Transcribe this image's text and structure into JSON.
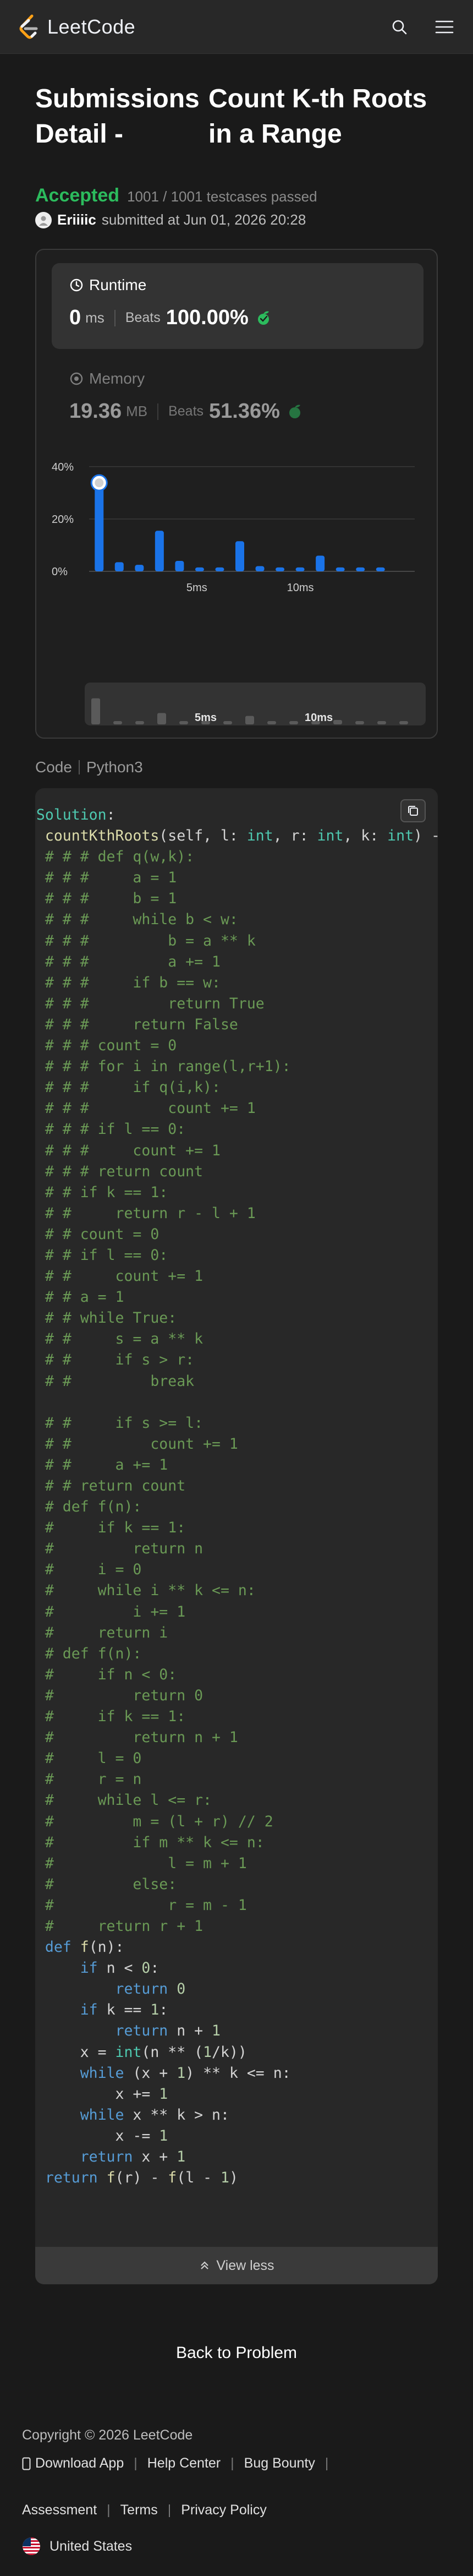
{
  "header": {
    "brand": "LeetCode"
  },
  "title": {
    "left": "Submissions Detail -",
    "right": "Count K-th Roots in a Range"
  },
  "status": {
    "accepted": "Accepted",
    "testcases": "1001 / 1001 testcases passed"
  },
  "author": {
    "name": "Eriiiic",
    "submitted": "submitted at Jun 01, 2026 20:28"
  },
  "runtime": {
    "label": "Runtime",
    "value": "0",
    "unit": "ms",
    "beats_label": "Beats",
    "beats": "100.00%"
  },
  "memory": {
    "label": "Memory",
    "value": "19.36",
    "unit": "MB",
    "beats_label": "Beats",
    "beats": "51.36%"
  },
  "chart_data": {
    "type": "bar",
    "title": "",
    "y_ticks": [
      "40%",
      "20%",
      "0%"
    ],
    "ylim": [
      0,
      45
    ],
    "x_tick_labels": [
      "5ms",
      "10ms"
    ],
    "series": [
      {
        "values": [
          35.5,
          3.5,
          2.5,
          15.5,
          4.0,
          1.5,
          1.5,
          11.5,
          2.0,
          1.5,
          1.5,
          6.0,
          1.5,
          1.5,
          1.5
        ]
      }
    ],
    "highlighted_index": 0,
    "colors": {
      "bar": "#1a73e8",
      "grid": "#3a3a3a"
    },
    "mini_x_tick_labels": [
      "5ms",
      "10ms"
    ]
  },
  "code": {
    "label": "Code",
    "language": "Python3",
    "lines": [
      "  Solution:",
      "ef countKthRoots(self, l: int, r: int, k: int) -> int:",
      "   # # # def q(w,k):",
      "   # # #     a = 1",
      "   # # #     b = 1",
      "   # # #     while b < w:",
      "   # # #         b = a ** k",
      "   # # #         a += 1",
      "   # # #     if b == w:",
      "   # # #         return True",
      "   # # #     return False",
      "   # # # count = 0",
      "   # # # for i in range(l,r+1):",
      "   # # #     if q(i,k):",
      "   # # #         count += 1",
      "   # # # if l == 0:",
      "   # # #     count += 1",
      "   # # # return count",
      "   # # if k == 1:",
      "   # #     return r - l + 1",
      "   # # count = 0",
      "   # # if l == 0:",
      "   # #     count += 1",
      "   # # a = 1",
      "   # # while True:",
      "   # #     s = a ** k",
      "   # #     if s > r:",
      "   # #         break",
      "",
      "   # #     if s >= l:",
      "   # #         count += 1",
      "   # #     a += 1",
      "   # # return count",
      "   # def f(n):",
      "   #     if k == 1:",
      "   #         return n",
      "   #     i = 0",
      "   #     while i ** k <= n:",
      "   #         i += 1",
      "   #     return i",
      "   # def f(n):",
      "   #     if n < 0:",
      "   #         return 0",
      "   #     if k == 1:",
      "   #         return n + 1",
      "   #     l = 0",
      "   #     r = n",
      "   #     while l <= r:",
      "   #         m = (l + r) // 2",
      "   #         if m ** k <= n:",
      "   #             l = m + 1",
      "   #         else:",
      "   #             r = m - 1",
      "   #     return r + 1",
      "   def f(n):",
      "       if n < 0:",
      "           return 0",
      "       if k == 1:",
      "           return n + 1",
      "       x = int(n ** (1/k))",
      "       while (x + 1) ** k <= n:",
      "           x += 1",
      "       while x ** k > n:",
      "           x -= 1",
      "       return x + 1",
      "   return f(r) - f(l - 1)"
    ],
    "view_less": "View less"
  },
  "back_to_problem": "Back to Problem",
  "footer": {
    "copyright": "Copyright © 2026 LeetCode",
    "links": [
      "Download App",
      "Help Center",
      "Bug Bounty",
      "Assessment",
      "Terms",
      "Privacy Policy"
    ],
    "country": "United States"
  }
}
